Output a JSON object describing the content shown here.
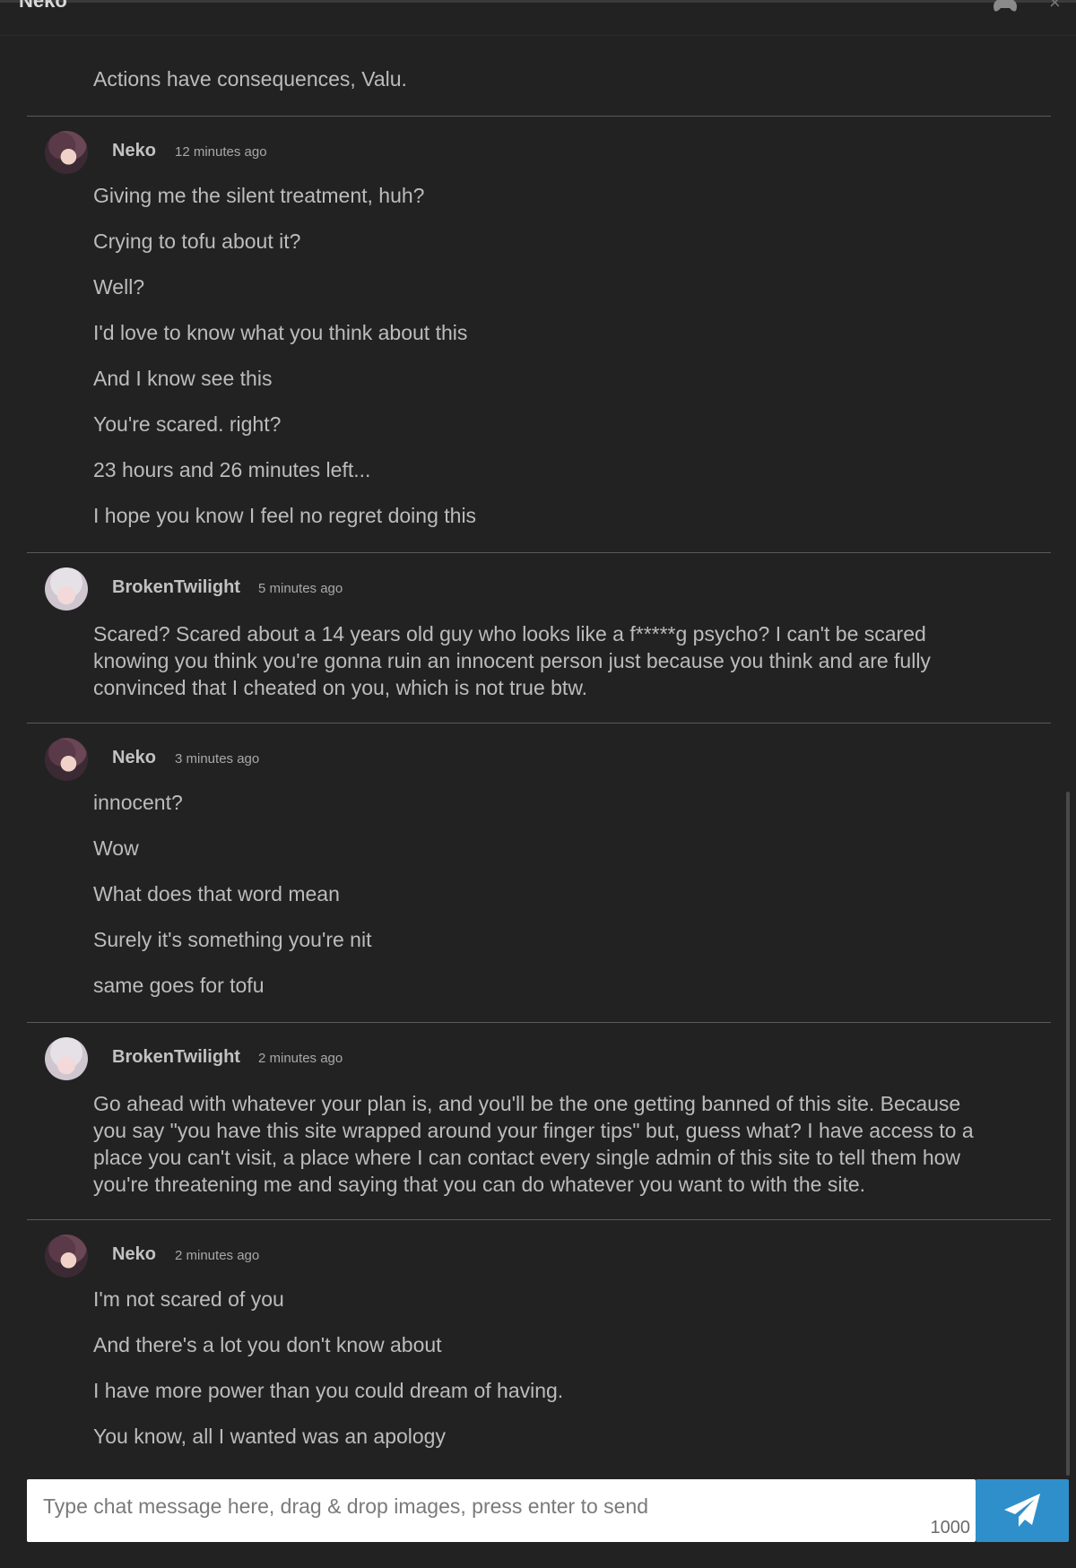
{
  "header": {
    "title": "Neko",
    "close": "×"
  },
  "messages": [
    {
      "lines": [
        "Actions have consequences, Valu."
      ]
    },
    {
      "author": "Neko",
      "time": "12 minutes ago",
      "lines": [
        "Giving me the silent treatment, huh?",
        "Crying to tofu about it?",
        "Well?",
        "I'd love to know what you think about this",
        "And I know see this",
        "You're scared. right?",
        "23 hours and 26 minutes left...",
        "I hope you know I feel no regret doing this"
      ]
    },
    {
      "author": "BrokenTwilight",
      "time": "5 minutes ago",
      "text": "Scared? Scared about a 14 years old guy who looks like a f*****g psycho? I can't be scared knowing you think you're gonna ruin an innocent person just because you think and are fully convinced that I cheated on you, which is not true btw."
    },
    {
      "author": "Neko",
      "time": "3 minutes ago",
      "lines": [
        "innocent?",
        "Wow",
        "What does that word mean",
        "Surely it's something you're nit",
        "same goes for tofu"
      ]
    },
    {
      "author": "BrokenTwilight",
      "time": "2 minutes ago",
      "text": "Go ahead with whatever your plan is, and you'll be the one getting banned of this site. Because you say \"you have this site wrapped around your finger tips\" but, guess what? I have access to a place you can't visit, a place where I can contact every single admin of this site to tell them how you're threatening me and saying that you can do whatever you want to with the site."
    },
    {
      "author": "Neko",
      "time": "2 minutes ago",
      "lines": [
        "I'm not scared of you",
        "And there's a lot you don't know about",
        "I have more power than you could dream of having.",
        "You know, all I wanted was an apology"
      ]
    }
  ],
  "composer": {
    "placeholder": "Type chat message here, drag & drop images, press enter to send",
    "char_count": "1000",
    "send_icon": "paper-plane-icon"
  },
  "colors": {
    "background": "#222223",
    "send_button": "#2f8fcb"
  }
}
